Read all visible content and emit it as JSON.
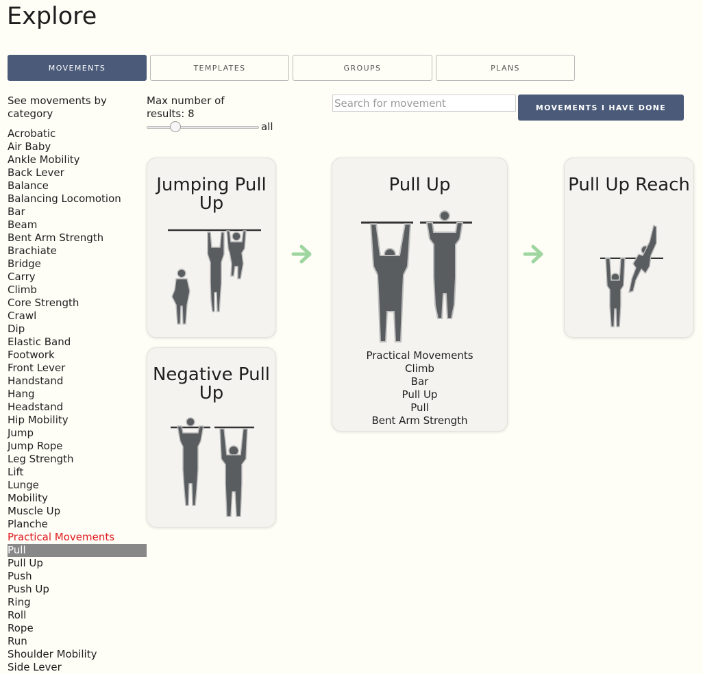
{
  "page": {
    "title": "Explore"
  },
  "tabs": [
    {
      "label": "MOVEMENTS",
      "active": true
    },
    {
      "label": "TEMPLATES",
      "active": false
    },
    {
      "label": "GROUPS",
      "active": false
    },
    {
      "label": "PLANS",
      "active": false
    }
  ],
  "categories": {
    "heading": "See movements by category",
    "items": [
      "Acrobatic",
      "Air Baby",
      "Ankle Mobility",
      "Back Lever",
      "Balance",
      "Balancing Locomotion",
      "Bar",
      "Beam",
      "Bent Arm Strength",
      "Brachiate",
      "Bridge",
      "Carry",
      "Climb",
      "Core Strength",
      "Crawl",
      "Dip",
      "Elastic Band",
      "Footwork",
      "Front Lever",
      "Handstand",
      "Hang",
      "Headstand",
      "Hip Mobility",
      "Jump",
      "Jump Rope",
      "Leg Strength",
      "Lift",
      "Lunge",
      "Mobility",
      "Muscle Up",
      "Planche",
      "Practical Movements",
      "Pull",
      "Pull Up",
      "Push",
      "Push Up",
      "Ring",
      "Roll",
      "Rope",
      "Run",
      "Shoulder Mobility",
      "Side Lever"
    ],
    "highlighted": "Practical Movements",
    "selected": "Pull"
  },
  "results": {
    "max_label": "Max number of results: 8",
    "value": 8,
    "all_label": "all"
  },
  "search": {
    "placeholder": "Search for movement",
    "value": ""
  },
  "done_button": {
    "label": "MOVEMENTS I HAVE DONE"
  },
  "cards": {
    "prev1": {
      "title": "Jumping Pull Up",
      "figure": "jumping-pull-up-figure"
    },
    "prev2": {
      "title": "Negative Pull Up",
      "figure": "negative-pull-up-figure"
    },
    "current": {
      "title": "Pull Up",
      "figure": "pull-up-figure",
      "tags": [
        "Practical Movements",
        "Climb",
        "Bar",
        "Pull Up",
        "Pull",
        "Bent Arm Strength"
      ]
    },
    "next": {
      "title": "Pull Up Reach",
      "figure": "pull-up-reach-figure"
    }
  },
  "icons": {
    "arrow": "arrow-right-icon"
  },
  "colors": {
    "background": "#fefdf6",
    "accent": "#4a5a78",
    "highlight": "#e0181e",
    "selected_bg": "#888888",
    "arrow": "#9fd6a0",
    "figure": "#5a5d60"
  }
}
